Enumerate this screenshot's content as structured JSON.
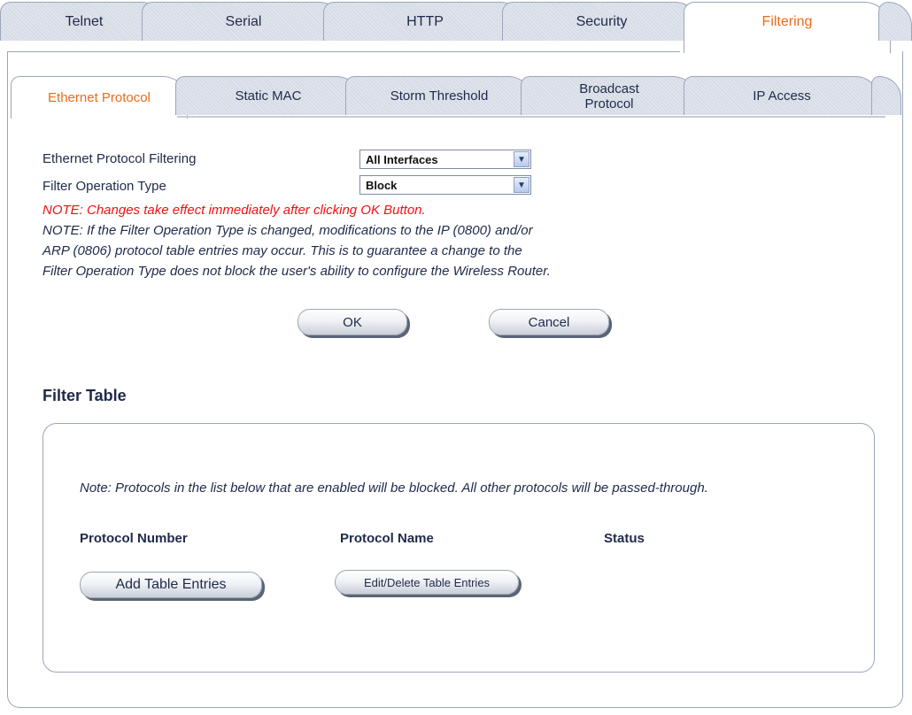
{
  "top_tabs": [
    {
      "label": "Telnet",
      "active": false
    },
    {
      "label": "Serial",
      "active": false
    },
    {
      "label": "HTTP",
      "active": false
    },
    {
      "label": "Security",
      "active": false
    },
    {
      "label": "Filtering",
      "active": true
    }
  ],
  "sub_tabs": [
    {
      "label": "Ethernet Protocol",
      "active": true
    },
    {
      "label": "Static MAC",
      "active": false
    },
    {
      "label": "Storm Threshold",
      "active": false
    },
    {
      "label": "Broadcast Protocol",
      "active": false
    },
    {
      "label": "IP Access",
      "active": false
    }
  ],
  "form": {
    "filtering_label": "Ethernet Protocol Filtering",
    "filtering_value": "All Interfaces",
    "operation_label": "Filter Operation Type",
    "operation_value": "Block"
  },
  "notes": {
    "red": "NOTE: Changes take effect immediately after clicking OK Button.",
    "line1": "NOTE: If the Filter Operation Type is changed, modifications to the IP (0800) and/or",
    "line2": "ARP (0806) protocol table entries may occur. This is to guarantee a change to the",
    "line3": "Filter Operation Type does not block the user's ability to configure the Wireless Router."
  },
  "buttons": {
    "ok": "OK",
    "cancel": "Cancel",
    "add": "Add Table Entries",
    "edit": "Edit/Delete Table Entries"
  },
  "filter_table": {
    "title": "Filter Table",
    "note": "Note: Protocols in the list below that are enabled will be blocked. All other protocols will be passed-through.",
    "columns": [
      "Protocol Number",
      "Protocol Name",
      "Status"
    ]
  },
  "colors": {
    "active_tab_text": "#ee6a1c",
    "warning_text": "#ee1111",
    "body_text": "#1e2a4a"
  },
  "icons": {
    "dropdown": "chevron-down-icon"
  }
}
